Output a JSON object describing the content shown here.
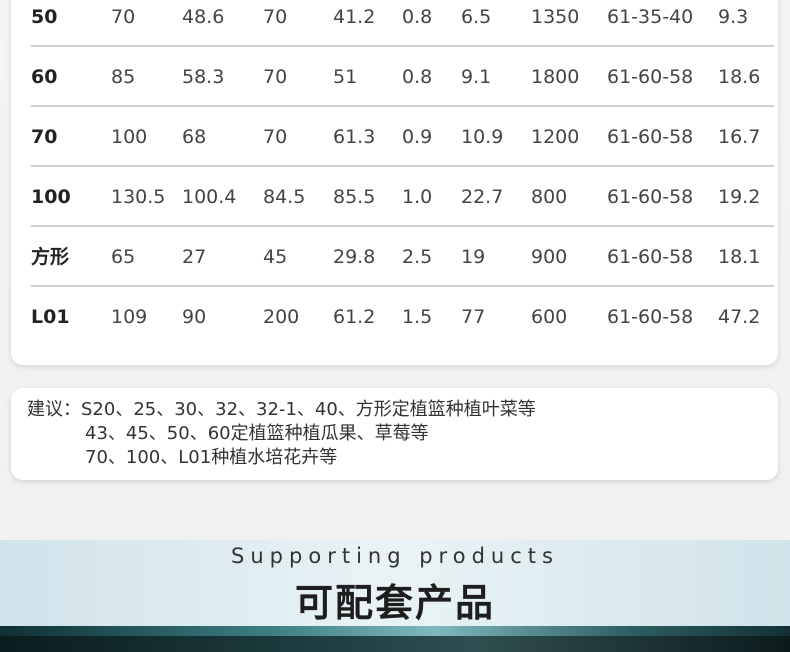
{
  "table": {
    "rows": [
      [
        "50",
        "70",
        "48.6",
        "70",
        "41.2",
        "0.8",
        "6.5",
        "1350",
        "61-35-40",
        "9.3"
      ],
      [
        "60",
        "85",
        "58.3",
        "70",
        "51",
        "0.8",
        "9.1",
        "1800",
        "61-60-58",
        "18.6"
      ],
      [
        "70",
        "100",
        "68",
        "70",
        "61.3",
        "0.9",
        "10.9",
        "1200",
        "61-60-58",
        "16.7"
      ],
      [
        "100",
        "130.5",
        "100.4",
        "84.5",
        "85.5",
        "1.0",
        "22.7",
        "800",
        "61-60-58",
        "19.2"
      ],
      [
        "方形",
        "65",
        "27",
        "45",
        "29.8",
        "2.5",
        "19",
        "900",
        "61-60-58",
        "18.1"
      ],
      [
        "L01",
        "109",
        "90",
        "200",
        "61.2",
        "1.5",
        "77",
        "600",
        "61-60-58",
        "47.2"
      ]
    ]
  },
  "note": {
    "line1": "建议：S20、25、30、32、32-1、40、方形定植篮种植叶菜等",
    "line2": "43、45、50、60定植篮种植瓜果、草莓等",
    "line3": "70、100、L01种植水培花卉等"
  },
  "promo": {
    "english": "Supporting products",
    "chinese": "可配套产品"
  }
}
